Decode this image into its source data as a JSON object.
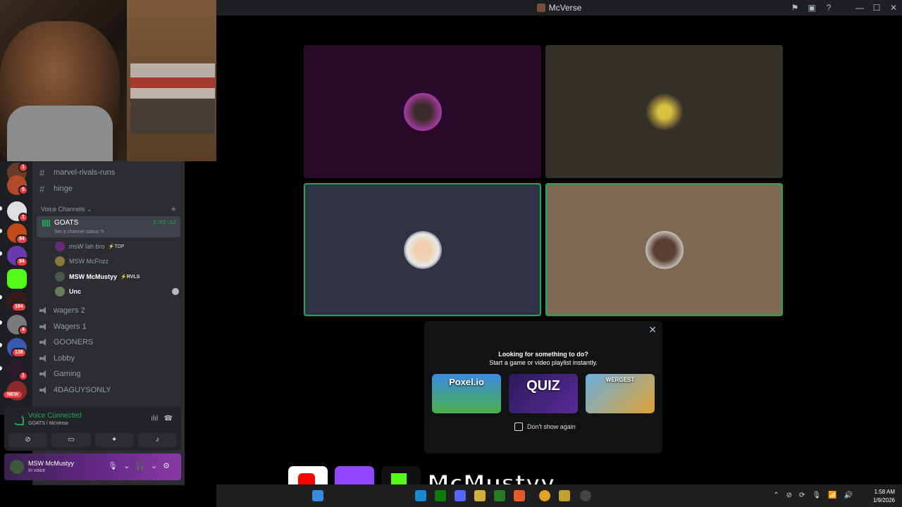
{
  "window": {
    "title": "McVerse"
  },
  "titlebar_icons": [
    "inbox-icon",
    "screen-icon",
    "help-icon"
  ],
  "window_controls": [
    "minimize",
    "maximize",
    "close"
  ],
  "server_badges": [
    "1",
    "5",
    "1",
    "94",
    "94",
    "194",
    "4",
    "138",
    "1"
  ],
  "server_new_badge": "NEW",
  "text_channels": [
    {
      "name": "marvel-rivals-runs"
    },
    {
      "name": "hinge"
    }
  ],
  "voice_category": "Voice Channels",
  "active_voice": {
    "name": "GOATS",
    "status": "Set a channel status",
    "timer": "3:02:32"
  },
  "members": [
    {
      "name": "msW lah bro",
      "tag": "TOP",
      "color": "#6a2a7a"
    },
    {
      "name": "MSW McFrizz",
      "tag": "",
      "color": "#8a7a3a"
    },
    {
      "name": "MSW McMustyy",
      "tag": "RVLS",
      "color": "#4a5a4a"
    },
    {
      "name": "Unc",
      "tag": "",
      "color": "#6a7a5a"
    }
  ],
  "voice_channels": [
    {
      "name": "wagers 2"
    },
    {
      "name": "Wagers 1"
    },
    {
      "name": "GOONERS"
    },
    {
      "name": "Lobby"
    },
    {
      "name": "Gaming"
    },
    {
      "name": "4DAGUYSONLY"
    }
  ],
  "voice_panel": {
    "status": "Voice Connected",
    "location": "GOATS / McVerse"
  },
  "user_panel": {
    "name": "MSW McMustyy",
    "status": "In voice"
  },
  "tiles": [
    {
      "bg": "#2a0a2a",
      "avatar": "#c040c0"
    },
    {
      "bg": "#33302a",
      "avatar": "#d8c040"
    },
    {
      "bg": "#2f3244",
      "avatar": "#e8e8e8"
    },
    {
      "bg": "#7e6a52",
      "avatar": "#5a4030"
    }
  ],
  "activity_popup": {
    "line1": "Looking for something to do?",
    "line2": "Start a game or video playlist instantly.",
    "activities": [
      "Poxel.io",
      "QUIZ",
      "WERGEST"
    ],
    "checkbox_label": "Don't show again"
  },
  "overlay": {
    "handle": "McMustyy"
  },
  "clock": {
    "time": "1:58 AM",
    "date": "1/9/2026"
  }
}
